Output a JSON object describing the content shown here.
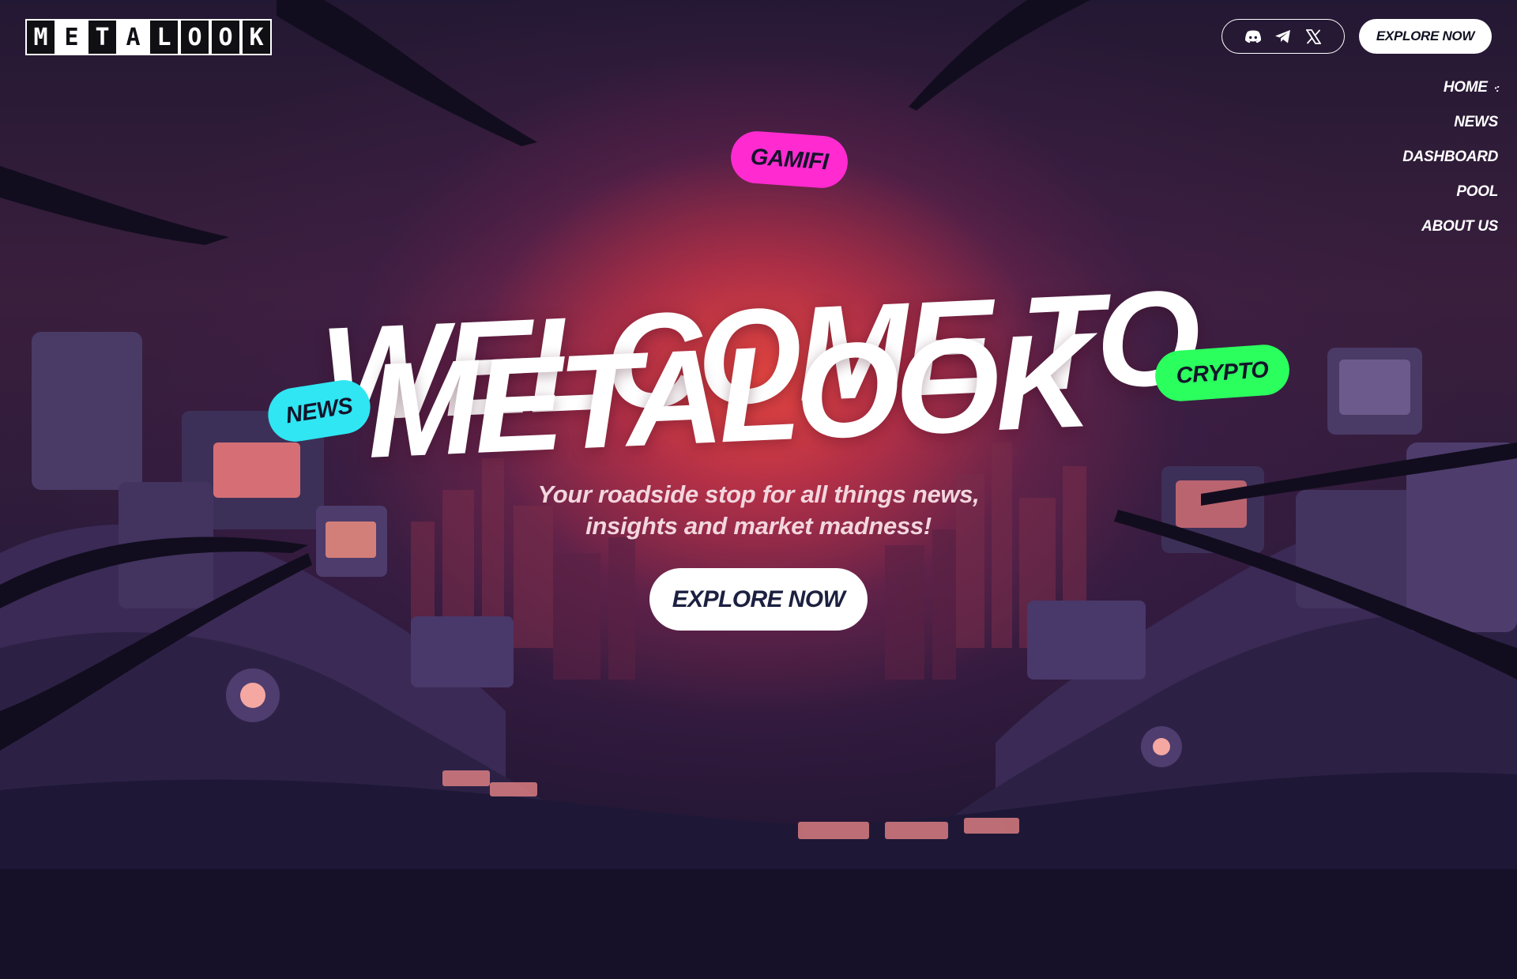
{
  "header": {
    "logo_letters": [
      "M",
      "E",
      "T",
      "A",
      "L",
      "O",
      "O",
      "K"
    ],
    "social_icons": [
      "discord-icon",
      "telegram-icon",
      "x-icon"
    ],
    "explore_label": "EXPLORE NOW"
  },
  "nav": {
    "items": [
      {
        "label": "HOME"
      },
      {
        "label": "NEWS"
      },
      {
        "label": "DASHBOARD"
      },
      {
        "label": "POOL"
      },
      {
        "label": "ABOUT US"
      }
    ],
    "active_indicator": "·:"
  },
  "hero": {
    "tags": {
      "gamifi": "GAMIFI",
      "news": "NEWS",
      "crypto": "CRYPTO"
    },
    "headline_line1": "WELCOME TO",
    "headline_line2": "METALOOK",
    "subtitle_line1": "Your roadside stop for all things news,",
    "subtitle_line2": "insights and market madness!",
    "cta_label": "EXPLORE NOW"
  },
  "colors": {
    "tag_gamifi": "#ff2bd0",
    "tag_news": "#2fe6f2",
    "tag_crypto": "#2bff5e",
    "glow": "#ec4840",
    "background": "#1a1230"
  }
}
